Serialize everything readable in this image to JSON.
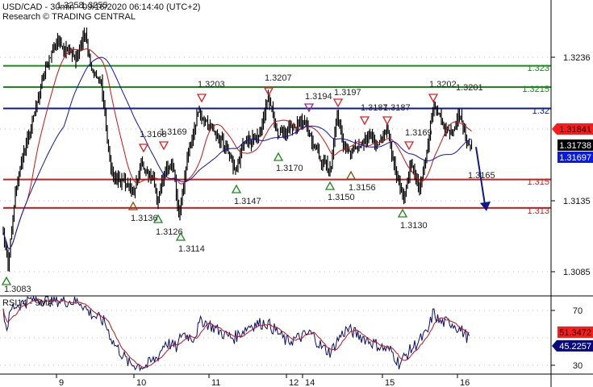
{
  "header": {
    "title": "USD/CAD - 30min - 09/16/2020 06:14:40 (UTC+2)",
    "subtitle": "Research © TRADING CENTRAL"
  },
  "chart_data": {
    "type": "candlestick",
    "title": "USD/CAD - 30min",
    "price_axis_ticks": [
      "1.3236",
      "1.3135",
      "1.3085"
    ],
    "date_ticks": [
      "9",
      "10",
      "11",
      "12",
      "14",
      "15",
      "16"
    ],
    "levels": [
      {
        "label": "1.323",
        "price": 1.323,
        "color": "#1a8a1a"
      },
      {
        "label": "1.3215",
        "price": 1.3215,
        "color": "#1a8a1a"
      },
      {
        "label": "1.32",
        "price": 1.32,
        "color": "#0a1a9a"
      },
      {
        "label": "1.315",
        "price": 1.315,
        "color": "#c81e1e"
      },
      {
        "label": "1.313",
        "price": 1.313,
        "color": "#c81e1e"
      }
    ],
    "peaks": [
      "1.3258",
      "1.3255",
      "1.3203",
      "1.3168",
      "1.3169",
      "1.3207",
      "1.3194",
      "1.3197",
      "1.3187",
      "1.3187",
      "1.3169",
      "1.3202",
      "1.3201"
    ],
    "troughs": [
      "1.3083",
      "1.3136",
      "1.3126",
      "1.3114",
      "1.3147",
      "1.3170",
      "1.3150",
      "1.3156",
      "1.3130",
      "1.3165"
    ],
    "price_tags": [
      {
        "label": "1.31841",
        "bg": "#ff1a1a",
        "fg": "#000000"
      },
      {
        "label": "1.31738",
        "bg": "#000000",
        "fg": "#ffffff"
      },
      {
        "label": "1.31697",
        "bg": "#0a1ae6",
        "fg": "#ffffff"
      }
    ],
    "forecast": {
      "from": 1.3174,
      "to": 1.313,
      "direction": "down"
    },
    "rsi": {
      "label": "RSI14 - 9MA",
      "ticks": [
        "70",
        "30"
      ],
      "range": [
        20,
        80
      ],
      "tags": [
        {
          "label": "51.3472",
          "bg": "#ff1a1a",
          "fg": "#000000"
        },
        {
          "label": "45.2257",
          "bg": "#0a0a80",
          "fg": "#ffffff"
        }
      ]
    }
  }
}
